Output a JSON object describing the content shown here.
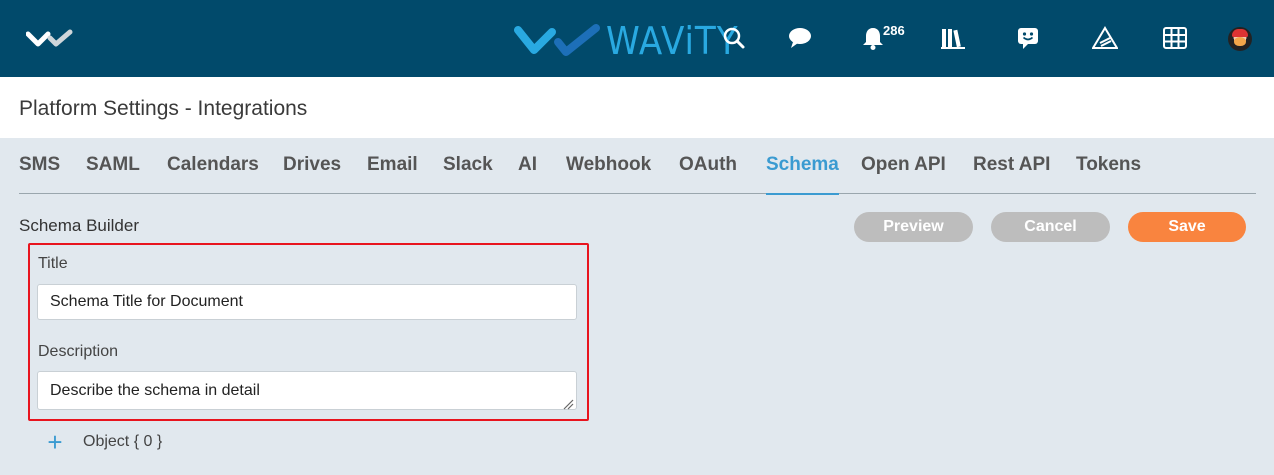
{
  "topbar": {
    "brand_name": "WAViTY",
    "notification_count": "286",
    "icons": [
      "corner-logo-icon",
      "search-icon",
      "chat-icon",
      "bell-icon",
      "library-icon",
      "feedback-icon",
      "road-icon",
      "grid-icon",
      "avatar"
    ]
  },
  "page": {
    "title": "Platform Settings - Integrations"
  },
  "tabs": [
    {
      "label": "SMS",
      "active": false
    },
    {
      "label": "SAML",
      "active": false
    },
    {
      "label": "Calendars",
      "active": false
    },
    {
      "label": "Drives",
      "active": false
    },
    {
      "label": "Email",
      "active": false
    },
    {
      "label": "Slack",
      "active": false
    },
    {
      "label": "AI",
      "active": false
    },
    {
      "label": "Webhook",
      "active": false
    },
    {
      "label": "OAuth",
      "active": false
    },
    {
      "label": "Schema",
      "active": true
    },
    {
      "label": "Open API",
      "active": false
    },
    {
      "label": "Rest API",
      "active": false
    },
    {
      "label": "Tokens",
      "active": false
    }
  ],
  "schema_builder": {
    "heading": "Schema Builder",
    "preview_label": "Preview",
    "cancel_label": "Cancel",
    "save_label": "Save",
    "title_label": "Title",
    "title_value": "Schema Title for Document",
    "description_label": "Description",
    "description_value": "Describe the schema in detail",
    "add_object_label": "Object { 0 }"
  },
  "colors": {
    "topbar": "#014a6b",
    "brand": "#29a9e1",
    "active_tab": "#3b9bd1",
    "save_button": "#f9843f",
    "secondary_button": "#bdbdbd",
    "highlight_border": "#e8141e",
    "background": "#e1e8ee"
  }
}
